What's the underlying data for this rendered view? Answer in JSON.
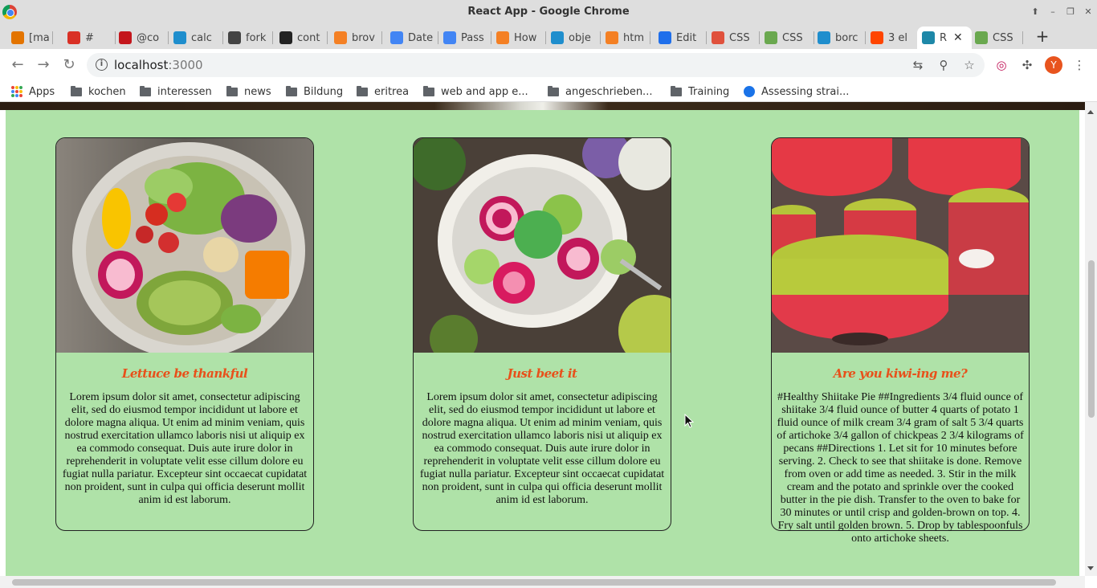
{
  "window": {
    "title": "React App - Google Chrome"
  },
  "tabs": [
    {
      "label": "[ma",
      "color": "#e37400"
    },
    {
      "label": "#",
      "color": "#d93025"
    },
    {
      "label": "@co",
      "color": "#c4161c"
    },
    {
      "label": "calc",
      "color": "#1f8ecd"
    },
    {
      "label": "fork",
      "color": "#444444"
    },
    {
      "label": "cont",
      "color": "#222222"
    },
    {
      "label": "brov",
      "color": "#f48024"
    },
    {
      "label": "Date",
      "color": "#4285f4"
    },
    {
      "label": "Pass",
      "color": "#4285f4"
    },
    {
      "label": "How",
      "color": "#f48024"
    },
    {
      "label": "obje",
      "color": "#1f8ecd"
    },
    {
      "label": "htm",
      "color": "#f48024"
    },
    {
      "label": "Edit",
      "color": "#1f6feb"
    },
    {
      "label": "CSS",
      "color": "#e0513c"
    },
    {
      "label": "CSS",
      "color": "#6aa84f"
    },
    {
      "label": "borc",
      "color": "#1f8ecd"
    },
    {
      "label": "3 el",
      "color": "#ff4500"
    },
    {
      "label": "R",
      "color": "#1e88a8"
    },
    {
      "label": "CSS",
      "color": "#6aa84f"
    }
  ],
  "toolbar": {
    "url_host": "localhost",
    "url_port": ":3000",
    "avatar_letter": "Y"
  },
  "bookmarks": [
    {
      "label": "Apps",
      "icon": "apps-grid-icon"
    },
    {
      "label": "kochen",
      "icon": "folder-icon"
    },
    {
      "label": "interessen",
      "icon": "folder-icon"
    },
    {
      "label": "news",
      "icon": "folder-icon"
    },
    {
      "label": "Bildung",
      "icon": "folder-icon"
    },
    {
      "label": "eritrea",
      "icon": "folder-icon"
    },
    {
      "label": "web and app e...",
      "icon": "folder-icon"
    },
    {
      "label": "angeschrieben...",
      "icon": "folder-icon"
    },
    {
      "label": "Training",
      "icon": "folder-icon"
    },
    {
      "label": "Assessing strai...",
      "icon": "site-icon"
    }
  ],
  "cards": [
    {
      "title": "Lettuce be thankful",
      "text": "Lorem ipsum dolor sit amet, consectetur adipiscing elit, sed do eiusmod tempor incididunt ut labore et dolore magna aliqua. Ut enim ad minim veniam, quis nostrud exercitation ullamco laboris nisi ut aliquip ex ea commodo consequat. Duis aute irure dolor in reprehenderit in voluptate velit esse cillum dolore eu fugiat nulla pariatur. Excepteur sint occaecat cupidatat non proident, sunt in culpa qui officia deserunt mollit anim id est laborum."
    },
    {
      "title": "Just beet it",
      "text": "Lorem ipsum dolor sit amet, consectetur adipiscing elit, sed do eiusmod tempor incididunt ut labore et dolore magna aliqua. Ut enim ad minim veniam, quis nostrud exercitation ullamco laboris nisi ut aliquip ex ea commodo consequat. Duis aute irure dolor in reprehenderit in voluptate velit esse cillum dolore eu fugiat nulla pariatur. Excepteur sint occaecat cupidatat non proident, sunt in culpa qui officia deserunt mollit anim id est laborum."
    },
    {
      "title": "Are you kiwi-ing me?",
      "text": "#Healthy Shiitake Pie ##Ingredients 3/4 fluid ounce of shiitake 3/4 fluid ounce of butter 4 quarts of potato 1 fluid ounce of milk cream 3/4 gram of salt 5 3/4 quarts of artichoke 3/4 gallon of chickpeas 2 3/4 kilograms of pecans ##Directions 1. Let sit for 10 minutes before serving. 2. Check to see that shiitake is done. Remove from oven or add time as needed. 3. Stir in the milk cream and the potato and sprinkle over the cooked butter in the pie dish. Transfer to the oven to bake for 30 minutes or until crisp and golden-brown on top. 4. Fry salt until golden brown. 5. Drop by tablespoonfuls onto artichoke sheets."
    }
  ],
  "colors": {
    "page_background": "#afe2a8",
    "card_title": "#e8501a"
  }
}
